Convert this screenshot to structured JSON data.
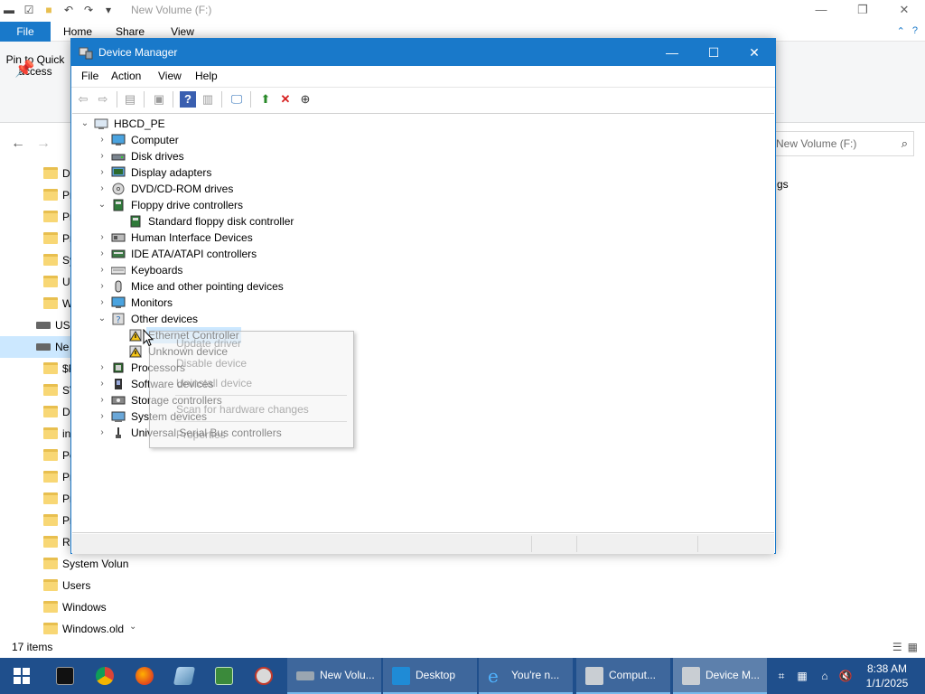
{
  "explorer": {
    "title": "New Volume (F:)",
    "tabs": {
      "file": "File",
      "home": "Home",
      "share": "Share",
      "view": "View"
    },
    "pin_label": "Pin to Quick access",
    "search_placeholder": "New Volume (F:)",
    "right_partial_text": "gs",
    "sidebar": [
      {
        "label": "D",
        "kind": "folder"
      },
      {
        "label": "Pr",
        "kind": "folder"
      },
      {
        "label": "Pr",
        "kind": "folder"
      },
      {
        "label": "Pr",
        "kind": "folder"
      },
      {
        "label": "Sy",
        "kind": "folder"
      },
      {
        "label": "U",
        "kind": "folder"
      },
      {
        "label": "W",
        "kind": "folder"
      },
      {
        "label": "USE",
        "kind": "drive"
      },
      {
        "label": "Ne",
        "kind": "drive",
        "selected": true
      },
      {
        "label": "$R",
        "kind": "folder"
      },
      {
        "label": "SV",
        "kind": "folder"
      },
      {
        "label": "D",
        "kind": "folder"
      },
      {
        "label": "in",
        "kind": "folder"
      },
      {
        "label": "Pe",
        "kind": "folder"
      },
      {
        "label": "Pr",
        "kind": "folder"
      },
      {
        "label": "Pr",
        "kind": "folder"
      },
      {
        "label": "Pr",
        "kind": "folder"
      },
      {
        "label": "Re",
        "kind": "folder"
      },
      {
        "label": "System Volun",
        "kind": "folder"
      },
      {
        "label": "Users",
        "kind": "folder"
      },
      {
        "label": "Windows",
        "kind": "folder"
      },
      {
        "label": "Windows.old",
        "kind": "folder"
      }
    ],
    "status": "17 items"
  },
  "devmgr": {
    "title": "Device Manager",
    "menu": [
      "File",
      "Action",
      "View",
      "Help"
    ],
    "tree": [
      {
        "label": "HBCD_PE",
        "level": 0,
        "exp": "v",
        "icon": "computer-root-icon"
      },
      {
        "label": "Computer",
        "level": 1,
        "exp": ">",
        "icon": "monitor-icon"
      },
      {
        "label": "Disk drives",
        "level": 1,
        "exp": ">",
        "icon": "disk-icon"
      },
      {
        "label": "Display adapters",
        "level": 1,
        "exp": ">",
        "icon": "display-adapter-icon"
      },
      {
        "label": "DVD/CD-ROM drives",
        "level": 1,
        "exp": ">",
        "icon": "dvd-icon"
      },
      {
        "label": "Floppy drive controllers",
        "level": 1,
        "exp": "v",
        "icon": "floppy-controller-icon"
      },
      {
        "label": "Standard floppy disk controller",
        "level": 2,
        "exp": "",
        "icon": "floppy-controller-icon"
      },
      {
        "label": "Human Interface Devices",
        "level": 1,
        "exp": ">",
        "icon": "hid-icon"
      },
      {
        "label": "IDE ATA/ATAPI controllers",
        "level": 1,
        "exp": ">",
        "icon": "ide-icon"
      },
      {
        "label": "Keyboards",
        "level": 1,
        "exp": ">",
        "icon": "keyboard-icon"
      },
      {
        "label": "Mice and other pointing devices",
        "level": 1,
        "exp": ">",
        "icon": "mouse-icon"
      },
      {
        "label": "Monitors",
        "level": 1,
        "exp": ">",
        "icon": "monitor-icon"
      },
      {
        "label": "Other devices",
        "level": 1,
        "exp": "v",
        "icon": "unknown-device-icon"
      },
      {
        "label": "Ethernet Controller",
        "level": 2,
        "exp": "",
        "icon": "warning-device-icon",
        "selected": true
      },
      {
        "label": "Unknown device",
        "level": 2,
        "exp": "",
        "icon": "warning-device-icon"
      },
      {
        "label": "Processors",
        "level": 1,
        "exp": ">",
        "icon": "processor-icon"
      },
      {
        "label": "Software devices",
        "level": 1,
        "exp": ">",
        "icon": "software-device-icon"
      },
      {
        "label": "Storage controllers",
        "level": 1,
        "exp": ">",
        "icon": "storage-controller-icon"
      },
      {
        "label": "System devices",
        "level": 1,
        "exp": ">",
        "icon": "system-device-icon"
      },
      {
        "label": "Universal Serial Bus controllers",
        "level": 1,
        "exp": ">",
        "icon": "usb-icon"
      }
    ],
    "context_menu": [
      "Update driver",
      "Disable device",
      "Uninstall device",
      "Scan for hardware changes",
      "Properties"
    ]
  },
  "taskbar": {
    "tasks": [
      {
        "label": "New Volu...",
        "icon": "drive-icon"
      },
      {
        "label": "Desktop",
        "icon": "desktop-icon"
      },
      {
        "label": "You're n...",
        "icon": "ie-icon"
      },
      {
        "label": "Comput...",
        "icon": "computer-management-icon"
      },
      {
        "label": "Device M...",
        "icon": "device-manager-icon"
      }
    ],
    "time": "8:38 AM",
    "date": "1/1/2025"
  },
  "colors": {
    "accent": "#1979ca",
    "taskbar": "#1f4f8c",
    "selection": "#cce8ff",
    "warning": "#f5c518"
  }
}
